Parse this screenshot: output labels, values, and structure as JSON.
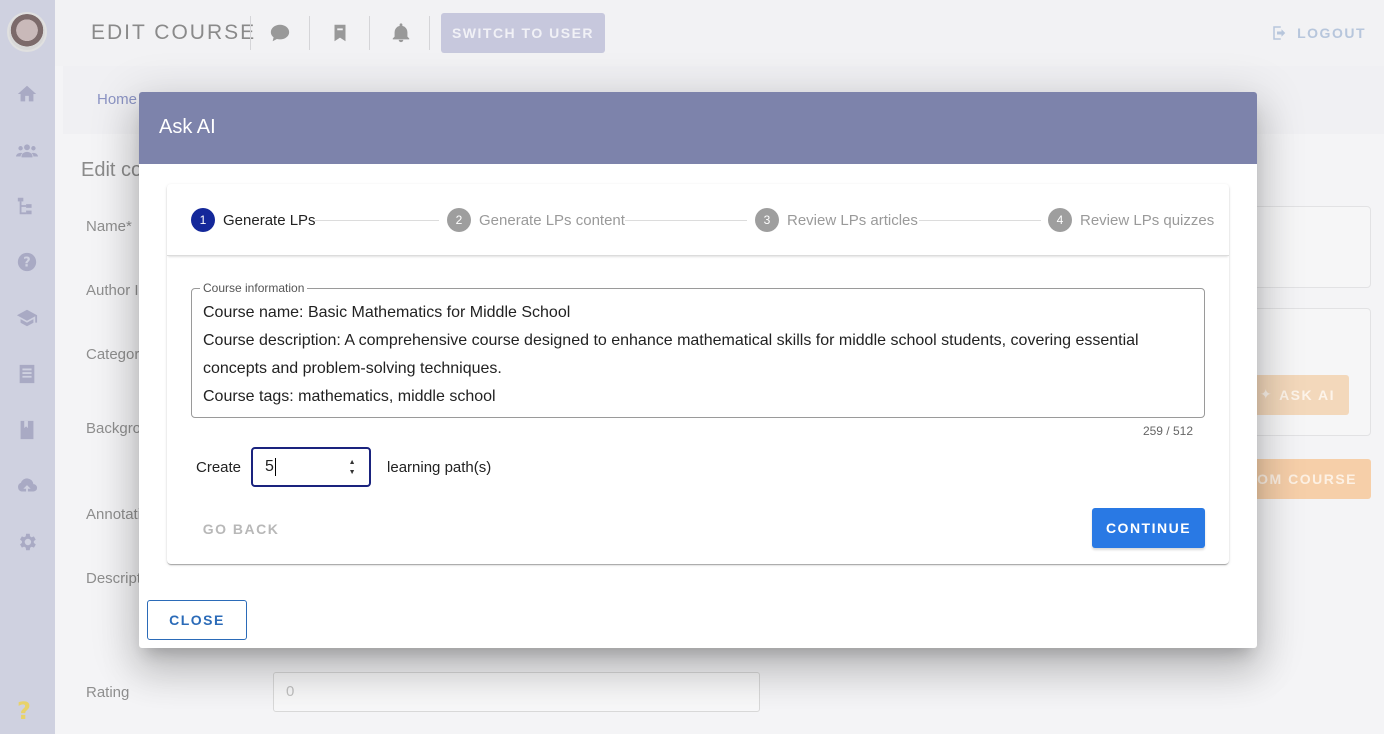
{
  "topbar": {
    "title": "EDIT COURSE",
    "switch_label": "SWITCH TO USER",
    "logout_label": "LOGOUT"
  },
  "breadcrumb": {
    "home": "Home"
  },
  "background_form": {
    "heading": "Edit co",
    "labels": [
      "Name*",
      "Author II",
      "Category",
      "Backgro",
      "Annotati",
      "Descript",
      "Rating"
    ],
    "rating_value": "0",
    "ask_ai_label": "ASK AI",
    "from_course_label": "ROM COURSE"
  },
  "dialog": {
    "title": "Ask AI",
    "steps": [
      {
        "number": "1",
        "label": "Generate LPs",
        "active": true
      },
      {
        "number": "2",
        "label": "Generate LPs content",
        "active": false
      },
      {
        "number": "3",
        "label": "Review LPs articles",
        "active": false
      },
      {
        "number": "4",
        "label": "Review LPs quizzes",
        "active": false
      }
    ],
    "course_info": {
      "legend": "Course information",
      "line1": "Course name: Basic Mathematics for Middle School",
      "line2": "Course description: A comprehensive course designed to enhance mathematical skills for middle school students, covering essential concepts and problem-solving techniques.",
      "line3": "Course tags: mathematics, middle school",
      "counter": "259 / 512"
    },
    "create_label": "Create",
    "create_value": "5",
    "create_suffix": "learning path(s)",
    "go_back_label": "GO BACK",
    "continue_label": "CONTINUE",
    "close_label": "CLOSE"
  },
  "colors": {
    "dialog_header": "#7d83ab",
    "active_step": "#14289a",
    "continue_button": "#2979e4",
    "sidebar": "#cfd1e0"
  },
  "icons": [
    "home-icon",
    "users-icon",
    "hierarchy-icon",
    "help-icon",
    "graduation-cap-icon",
    "document-icon",
    "bookmark-book-icon",
    "cloud-upload-icon",
    "settings-icon",
    "chat-icon",
    "bookmark-icon",
    "bell-icon",
    "logout-icon"
  ]
}
